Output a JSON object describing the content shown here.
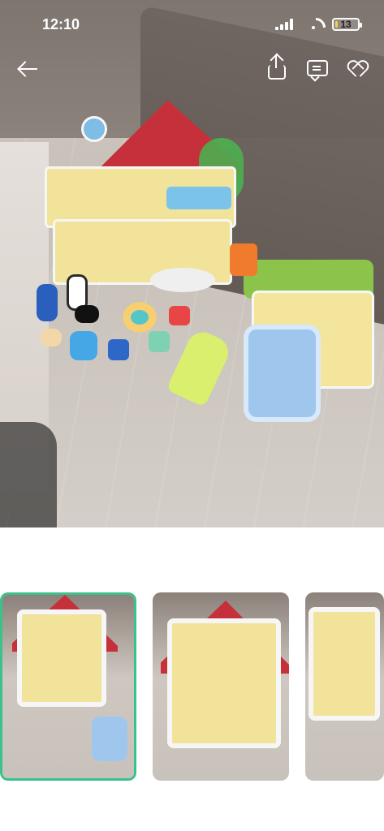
{
  "status": {
    "time": "12:10",
    "battery_level_text": "13",
    "battery_fraction": 0.13
  },
  "header": {
    "back_icon": "back-arrow-icon",
    "share_icon": "share-icon",
    "message_icon": "message-icon",
    "favorite_icon": "heart-icon"
  },
  "gallery": {
    "selected_index": 0,
    "thumbnails": [
      {
        "name": "thumb-1"
      },
      {
        "name": "thumb-2"
      },
      {
        "name": "thumb-3"
      }
    ]
  },
  "colors": {
    "selected_thumb_border": "#39c28a",
    "battery_fill": "#f2d44d"
  }
}
